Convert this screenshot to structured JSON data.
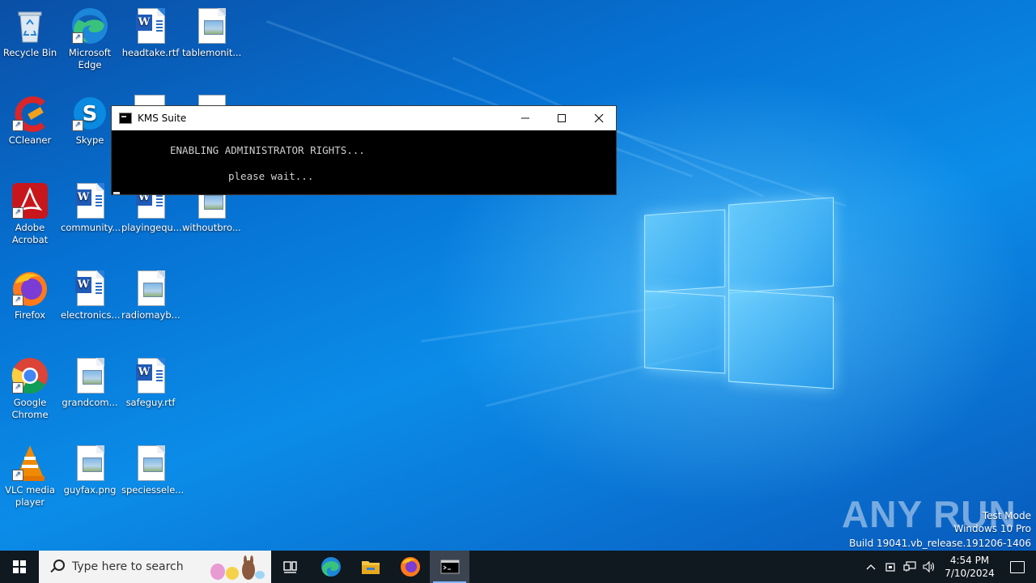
{
  "desktop": {
    "icons": [
      {
        "label": "Recycle Bin",
        "icon": "recycle-bin-icon"
      },
      {
        "label": "Microsoft Edge",
        "icon": "edge-icon"
      },
      {
        "label": "headtake.rtf",
        "icon": "word-doc-icon"
      },
      {
        "label": "tablemonit...",
        "icon": "image-file-icon"
      },
      {
        "label": "CCleaner",
        "icon": "ccleaner-icon"
      },
      {
        "label": "Skype",
        "icon": "skype-icon"
      },
      {
        "label": "Adobe Acrobat",
        "icon": "acrobat-icon"
      },
      {
        "label": "community...",
        "icon": "word-doc-icon"
      },
      {
        "label": "playingequ...",
        "icon": "word-doc-icon"
      },
      {
        "label": "withoutbro...",
        "icon": "image-file-icon"
      },
      {
        "label": "Firefox",
        "icon": "firefox-icon"
      },
      {
        "label": "electronics...",
        "icon": "word-doc-icon"
      },
      {
        "label": "radiomayb...",
        "icon": "image-file-icon"
      },
      {
        "label": "Google Chrome",
        "icon": "chrome-icon"
      },
      {
        "label": "grandcom...",
        "icon": "image-file-icon"
      },
      {
        "label": "safeguy.rtf",
        "icon": "word-doc-icon"
      },
      {
        "label": "VLC media player",
        "icon": "vlc-icon"
      },
      {
        "label": "guyfax.png",
        "icon": "image-file-icon"
      },
      {
        "label": "speciessele...",
        "icon": "image-file-icon"
      }
    ]
  },
  "console_window": {
    "title": "KMS Suite",
    "line1": "ENABLING ADMINISTRATOR RIGHTS...",
    "line2": "please wait..."
  },
  "watermark": {
    "brand": "ANY RUN",
    "mode": "Test Mode",
    "edition": "Windows 10 Pro",
    "build": "Build 19041.vb_release.191206-1406"
  },
  "taskbar": {
    "search_placeholder": "Type here to search",
    "pinned": [
      "task-view",
      "edge",
      "file-explorer",
      "firefox",
      "cmd"
    ],
    "time": "4:54 PM",
    "date": "7/10/2024"
  }
}
